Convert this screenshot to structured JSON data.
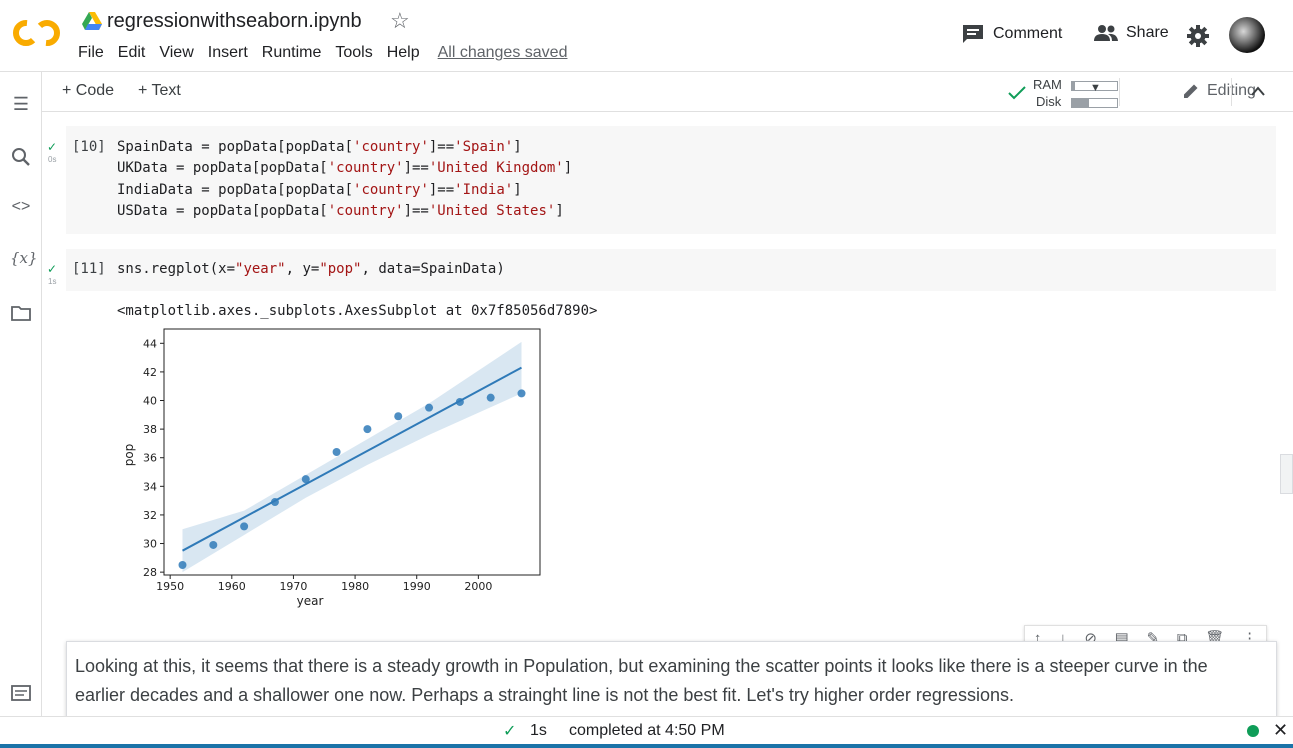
{
  "header": {
    "title": "regressionwithseaborn.ipynb",
    "menu": [
      "File",
      "Edit",
      "View",
      "Insert",
      "Runtime",
      "Tools",
      "Help"
    ],
    "saved_status": "All changes saved",
    "comment_label": "Comment",
    "share_label": "Share"
  },
  "toolbar": {
    "add_code": "+ Code",
    "add_text": "+ Text",
    "ram_label": "RAM",
    "disk_label": "Disk",
    "editing_label": "Editing"
  },
  "cells": {
    "cell1": {
      "count": "[10]",
      "time": "0s",
      "lines": [
        [
          "SpainData = popData[popData[",
          "'country'",
          "]==",
          "'Spain'",
          "]"
        ],
        [
          "UKData = popData[popData[",
          "'country'",
          "]==",
          "'United Kingdom'",
          "]"
        ],
        [
          "IndiaData = popData[popData[",
          "'country'",
          "]==",
          "'India'",
          "]"
        ],
        [
          "USData = popData[popData[",
          "'country'",
          "]==",
          "'United States'",
          "]"
        ]
      ]
    },
    "cell2": {
      "count": "[11]",
      "time": "1s",
      "code_pre": "sns.regplot(x=",
      "code_s1": "\"year\"",
      "code_mid": ", y=",
      "code_s2": "\"pop\"",
      "code_post": ", data=SpainData)",
      "output": "<matplotlib.axes._subplots.AxesSubplot at 0x7f85056d7890>"
    }
  },
  "chart_data": {
    "type": "scatter",
    "xlabel": "year",
    "ylabel": "pop",
    "xlim": [
      1949,
      2010
    ],
    "ylim": [
      27.8,
      45
    ],
    "xticks": [
      1950,
      1960,
      1970,
      1980,
      1990,
      2000
    ],
    "yticks": [
      28,
      30,
      32,
      34,
      36,
      38,
      40,
      42,
      44
    ],
    "x": [
      1952,
      1957,
      1962,
      1967,
      1972,
      1977,
      1982,
      1987,
      1992,
      1997,
      2002,
      2007
    ],
    "y": [
      28.5,
      29.9,
      31.2,
      32.9,
      34.5,
      36.4,
      38.0,
      38.9,
      39.5,
      39.9,
      40.2,
      40.5
    ],
    "regression_line": {
      "x": [
        1952,
        2007
      ],
      "y": [
        29.5,
        42.3
      ]
    },
    "ci_band": {
      "x": [
        1952,
        1962,
        1972,
        1982,
        1992,
        2007
      ],
      "lower": [
        28.0,
        30.6,
        33.2,
        35.5,
        37.6,
        40.5
      ],
      "upper": [
        31.0,
        32.3,
        34.8,
        37.3,
        39.8,
        44.1
      ]
    },
    "color": "#2f7ab8",
    "grid": false
  },
  "text_cell": {
    "text": "Looking at this, it seems that there is a steady growth in Population, but examining the scatter points it looks like there is a steeper curve in the earlier decades and a shallower one now. Perhaps a strainght line is not the best fit. Let's try higher order regressions."
  },
  "statusbar": {
    "check": "✓",
    "time": "1s",
    "completed": "completed at 4:50 PM"
  },
  "colors": {
    "accent_orange": "#f9ab00",
    "success_green": "#0f9d58",
    "string_red": "#a31515"
  }
}
